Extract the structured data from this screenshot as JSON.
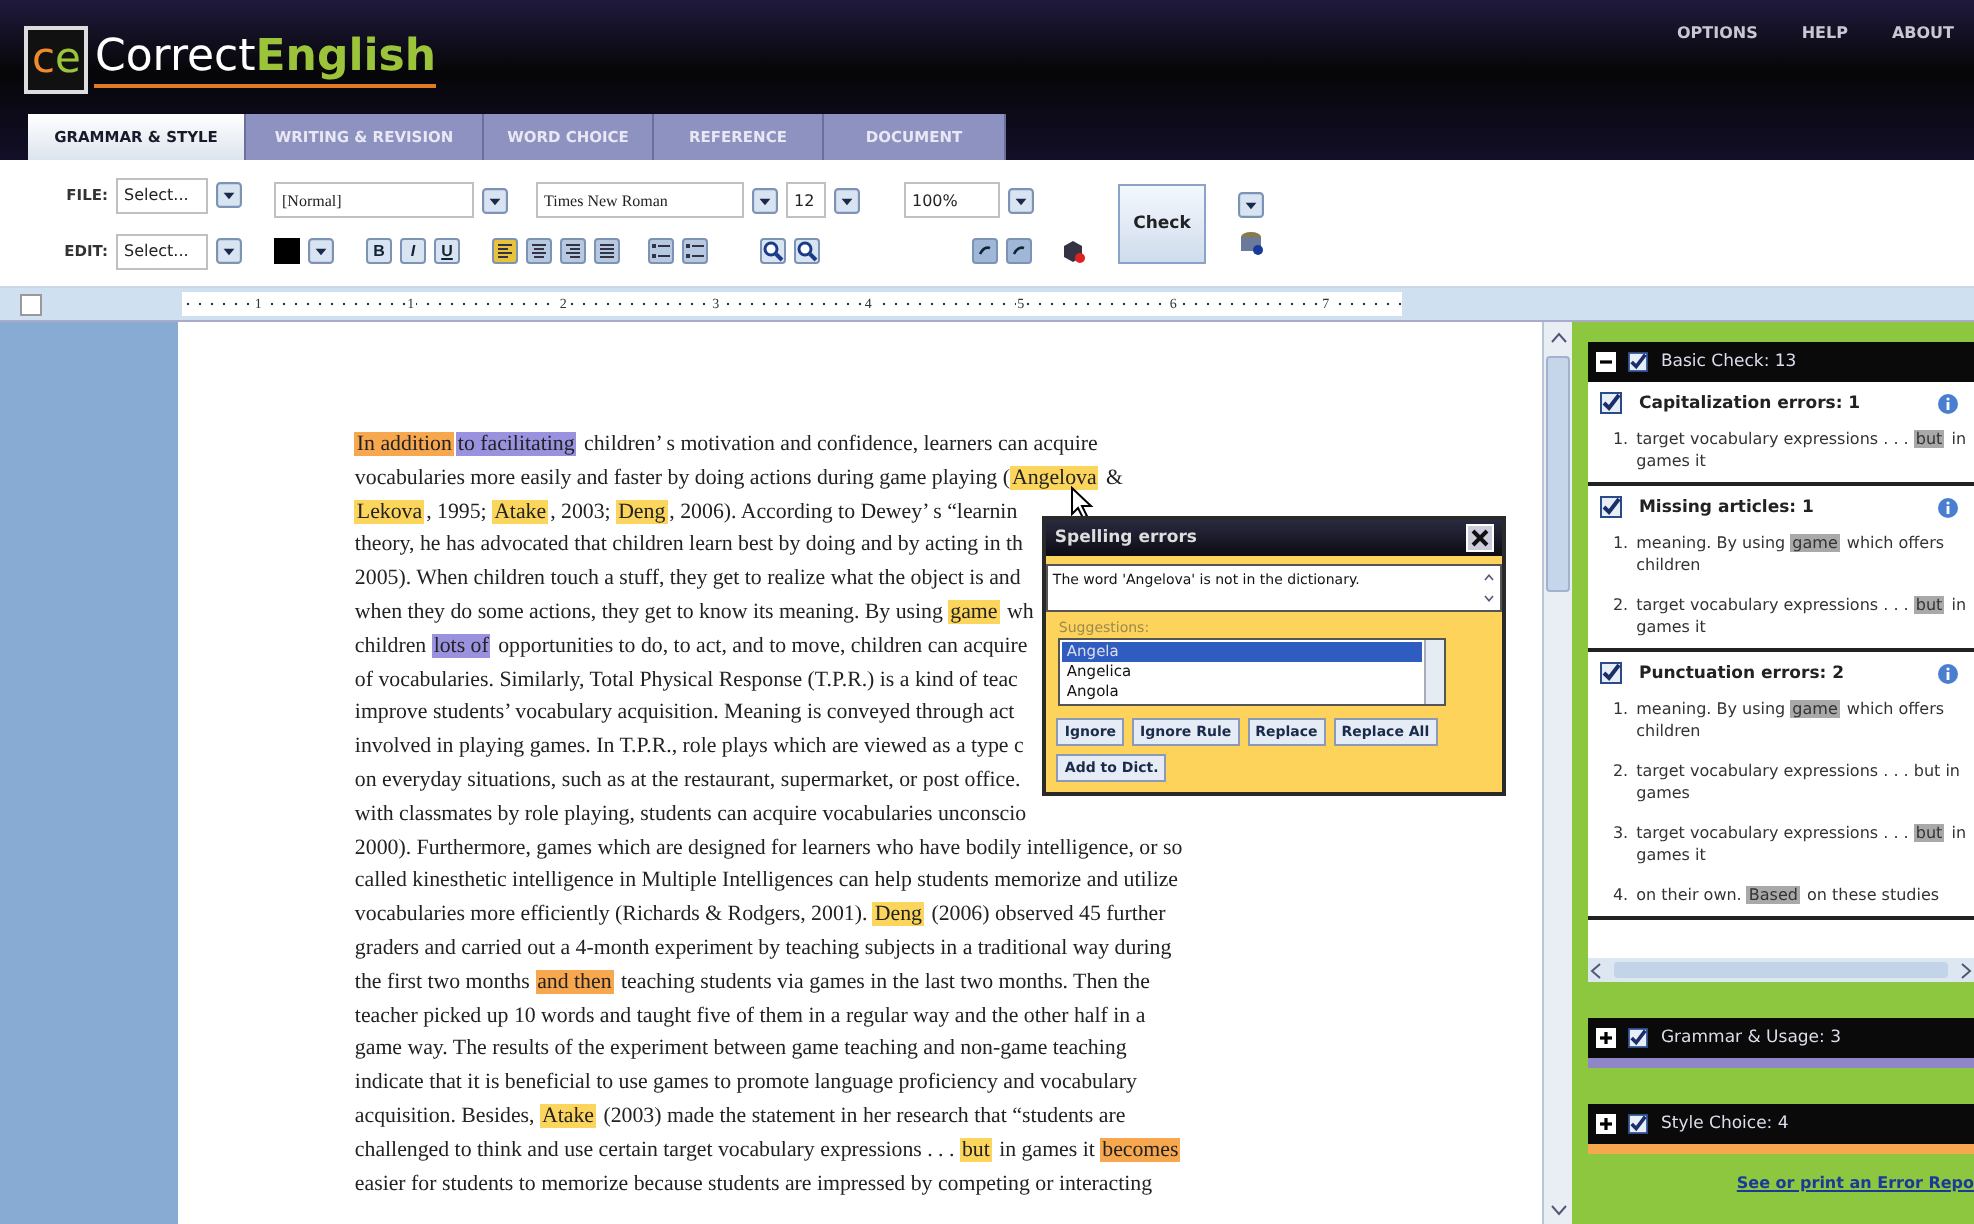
{
  "header": {
    "logo": {
      "mark": [
        "c",
        "e"
      ],
      "name": [
        "Correct",
        "English"
      ]
    },
    "links": [
      "OPTIONS",
      "HELP",
      "ABOUT"
    ],
    "tabs": [
      {
        "label": "GRAMMAR & STYLE",
        "selected": true
      },
      {
        "label": "WRITING & REVISION",
        "selected": false
      },
      {
        "label": "WORD CHOICE",
        "selected": false
      },
      {
        "label": "REFERENCE",
        "selected": false
      },
      {
        "label": "DOCUMENT",
        "selected": false
      }
    ]
  },
  "toolbar": {
    "file": {
      "label": "FILE:",
      "value": "Select..."
    },
    "edit": {
      "label": "EDIT:",
      "value": "Select..."
    },
    "style": "[Normal]",
    "font": "Times New Roman",
    "size": "12",
    "zoom": "100%",
    "format_buttons": [
      "B",
      "I",
      "U"
    ],
    "alignments": [
      {
        "selected": true
      },
      {
        "selected": false
      },
      {
        "selected": false
      },
      {
        "selected": false
      }
    ],
    "check_button": "Check"
  },
  "ruler": {
    "marks": [
      "1",
      "1",
      "2",
      "3",
      "4",
      "5",
      "6",
      "7"
    ]
  },
  "document": {
    "lines": [
      {
        "segments": [
          {
            "text": "In addition",
            "color": "#f7a84e"
          },
          {
            "text": "to facilitating",
            "color": "#9b92df"
          },
          {
            "text": " children’ s motivation and confidence, learners can acquire"
          }
        ]
      },
      {
        "segments": [
          {
            "text": "vocabularies more easily and faster by doing actions during game playing ("
          },
          {
            "text": "Angelova",
            "color": "#fbd55c"
          },
          {
            "text": " &"
          }
        ]
      },
      {
        "segments": [
          {
            "text": "Lekova",
            "color": "#fbd55c"
          },
          {
            "text": ", 1995; "
          },
          {
            "text": "Atake",
            "color": "#fbd55c"
          },
          {
            "text": ", 2003; "
          },
          {
            "text": "Deng",
            "color": "#fbd55c"
          },
          {
            "text": ", 2006). According to Dewey’ s “learnin"
          }
        ]
      },
      {
        "segments": [
          {
            "text": "theory, he has advocated that children learn best by doing and by acting in th"
          }
        ]
      },
      {
        "segments": [
          {
            "text": "2005). When children touch a stuff, they get to realize what the object is and"
          }
        ]
      },
      {
        "segments": [
          {
            "text": "when they do some actions, they get to know its meaning. By using "
          },
          {
            "text": "game",
            "color": "#fbd55c"
          },
          {
            "text": " wh"
          }
        ]
      },
      {
        "segments": [
          {
            "text": "children "
          },
          {
            "text": "lots of",
            "color": "#9b92df"
          },
          {
            "text": " opportunities to do, to act, and to move, children can acquire"
          }
        ]
      },
      {
        "segments": [
          {
            "text": "of vocabularies. Similarly, Total Physical Response (T.P.R.) is a kind of teac"
          }
        ]
      },
      {
        "segments": [
          {
            "text": "improve students’   vocabulary acquisition. Meaning is conveyed through act"
          }
        ]
      },
      {
        "segments": [
          {
            "text": "involved in playing games. In T.P.R., role plays which are viewed as a type c"
          }
        ]
      },
      {
        "segments": [
          {
            "text": "on everyday situations, such as at the restaurant, supermarket, or post office."
          }
        ]
      },
      {
        "segments": [
          {
            "text": "with classmates by role playing, students can acquire vocabularies unconscio"
          }
        ]
      },
      {
        "segments": [
          {
            "text": "2000). Furthermore, games which are designed for learners who have bodily intelligence, or so"
          }
        ]
      },
      {
        "segments": [
          {
            "text": "called kinesthetic intelligence in Multiple Intelligences can help students memorize and utilize"
          }
        ]
      },
      {
        "segments": [
          {
            "text": "vocabularies more efficiently (Richards & Rodgers, 2001). "
          },
          {
            "text": "Deng",
            "color": "#fbd55c"
          },
          {
            "text": " (2006) observed 45 further"
          }
        ]
      },
      {
        "segments": [
          {
            "text": "graders and carried out a 4-month experiment by teaching subjects in a traditional way during"
          }
        ]
      },
      {
        "segments": [
          {
            "text": "the first two months "
          },
          {
            "text": "and then",
            "color": "#f7a84e"
          },
          {
            "text": " teaching students via games in the last two months. Then the"
          }
        ]
      },
      {
        "segments": [
          {
            "text": "teacher picked up 10 words and taught five of them in a regular way and the other half in a"
          }
        ]
      },
      {
        "segments": [
          {
            "text": "game way. The results of the experiment between game teaching and non-game teaching"
          }
        ]
      },
      {
        "segments": [
          {
            "text": "indicate that it is beneficial to use games to promote language proficiency and vocabulary"
          }
        ]
      },
      {
        "segments": [
          {
            "text": "acquisition. Besides, "
          },
          {
            "text": "Atake",
            "color": "#fbd55c"
          },
          {
            "text": " (2003) made the statement in her research that  “students are"
          }
        ]
      },
      {
        "segments": [
          {
            "text": "challenged to think and use certain target vocabulary expressions . . . "
          },
          {
            "text": "but",
            "color": "#fbd55c"
          },
          {
            "text": " in games it "
          },
          {
            "text": "becomes",
            "color": "#f7a84e"
          }
        ]
      },
      {
        "segments": [
          {
            "text": "easier for students to memorize because students are impressed by competing or interacting"
          }
        ]
      }
    ]
  },
  "popup": {
    "title": "Spelling errors",
    "message": "The word 'Angelova' is not in the dictionary.",
    "suggestions_label": "Suggestions:",
    "suggestions": [
      {
        "label": "Angela",
        "selected": true
      },
      {
        "label": "Angelica",
        "selected": false
      },
      {
        "label": "Angola",
        "selected": false
      }
    ],
    "buttons": [
      "Ignore",
      "Ignore Rule",
      "Replace",
      "Replace All",
      "Add to Dict."
    ]
  },
  "panel": {
    "basic_check": {
      "title": "Basic Check: 13",
      "expanded": true,
      "checked": true,
      "groups": [
        {
          "title": "Capitalization errors: 1",
          "checked": true,
          "items": [
            {
              "number": "1.",
              "lines": [
                [
                  {
                    "text": "target vocabulary expressions . . . "
                  },
                  {
                    "text": "but",
                    "color": "#a9a9a9"
                  },
                  {
                    "text": " in"
                  }
                ],
                [
                  {
                    "text": "games it"
                  }
                ]
              ]
            }
          ]
        },
        {
          "title": "Missing articles: 1",
          "checked": true,
          "items": [
            {
              "number": "1.",
              "lines": [
                [
                  {
                    "text": "meaning. By using "
                  },
                  {
                    "text": "game",
                    "color": "#a9a9a9"
                  },
                  {
                    "text": " which offers"
                  }
                ],
                [
                  {
                    "text": "children"
                  }
                ]
              ]
            },
            {
              "number": "2.",
              "lines": [
                [
                  {
                    "text": "target vocabulary expressions . . . "
                  },
                  {
                    "text": "but",
                    "color": "#a9a9a9"
                  },
                  {
                    "text": " in"
                  }
                ],
                [
                  {
                    "text": "games it"
                  }
                ]
              ]
            }
          ]
        },
        {
          "title": "Punctuation errors: 2",
          "checked": true,
          "items": [
            {
              "number": "1.",
              "lines": [
                [
                  {
                    "text": "meaning. By using "
                  },
                  {
                    "text": "game",
                    "color": "#a9a9a9"
                  },
                  {
                    "text": " which offers"
                  }
                ],
                [
                  {
                    "text": "children"
                  }
                ]
              ]
            },
            {
              "number": "2.",
              "lines": [
                [
                  {
                    "text": "target vocabulary expressions . . . but in"
                  }
                ],
                [
                  {
                    "text": "games"
                  }
                ]
              ]
            },
            {
              "number": "3.",
              "lines": [
                [
                  {
                    "text": "target vocabulary expressions . . . "
                  },
                  {
                    "text": "but",
                    "color": "#a9a9a9"
                  },
                  {
                    "text": " in"
                  }
                ],
                [
                  {
                    "text": "games it"
                  }
                ]
              ]
            },
            {
              "number": "4.",
              "lines": [
                [
                  {
                    "text": "on their own. "
                  },
                  {
                    "text": "Based",
                    "color": "#a9a9a9"
                  },
                  {
                    "text": " on these studies"
                  }
                ]
              ]
            }
          ]
        }
      ]
    },
    "sections": [
      {
        "title": "Grammar & Usage: 3",
        "expanded": false,
        "checked": true,
        "color": "#8f86c8"
      },
      {
        "title": "Style Choice: 4",
        "expanded": false,
        "checked": true,
        "color": "#f7a84e"
      }
    ],
    "report_link": "See or print an Error Repo"
  }
}
